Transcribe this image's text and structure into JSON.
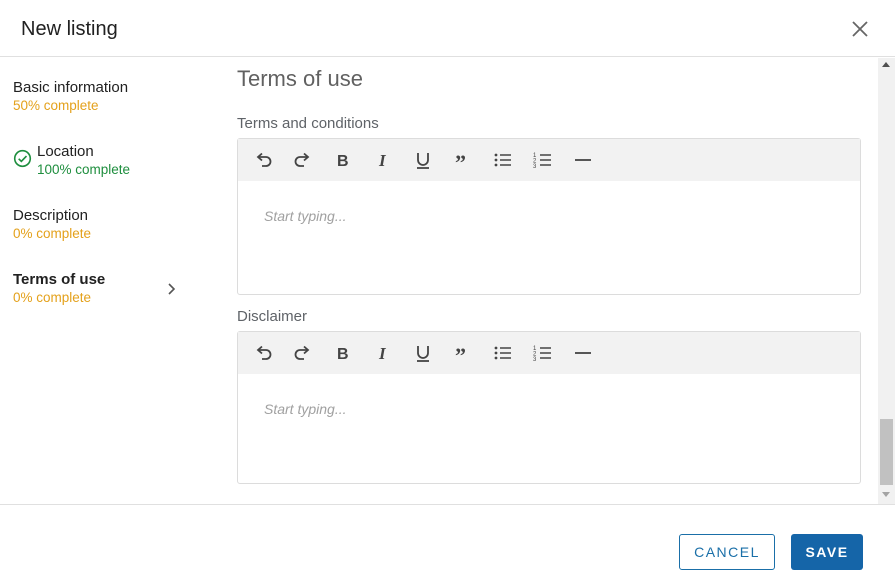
{
  "dialog": {
    "title": "New listing",
    "close_icon": "close-icon"
  },
  "sidebar": {
    "steps": [
      {
        "title": "Basic information",
        "status": "50% complete",
        "status_color": "#e4a11b",
        "completed": false,
        "active": false
      },
      {
        "title": "Location",
        "status": "100% complete",
        "status_color": "#1e8e3e",
        "completed": true,
        "active": false
      },
      {
        "title": "Description",
        "status": "0% complete",
        "status_color": "#e4a11b",
        "completed": false,
        "active": false
      },
      {
        "title": "Terms of use",
        "status": "0% complete",
        "status_color": "#e4a11b",
        "completed": false,
        "active": true
      }
    ]
  },
  "main": {
    "section_title": "Terms of use",
    "fields": [
      {
        "label": "Terms and conditions",
        "placeholder": "Start typing..."
      },
      {
        "label": "Disclaimer",
        "placeholder": "Start typing..."
      }
    ],
    "toolbar_icons": [
      "undo-icon",
      "redo-icon",
      "bold-icon",
      "italic-icon",
      "underline-icon",
      "blockquote-icon",
      "bulleted-list-icon",
      "numbered-list-icon",
      "horizontal-rule-icon"
    ]
  },
  "footer": {
    "cancel_label": "CANCEL",
    "save_label": "SAVE"
  },
  "colors": {
    "primary": "#1565a8",
    "complete": "#1e8e3e",
    "incomplete": "#e4a11b"
  }
}
